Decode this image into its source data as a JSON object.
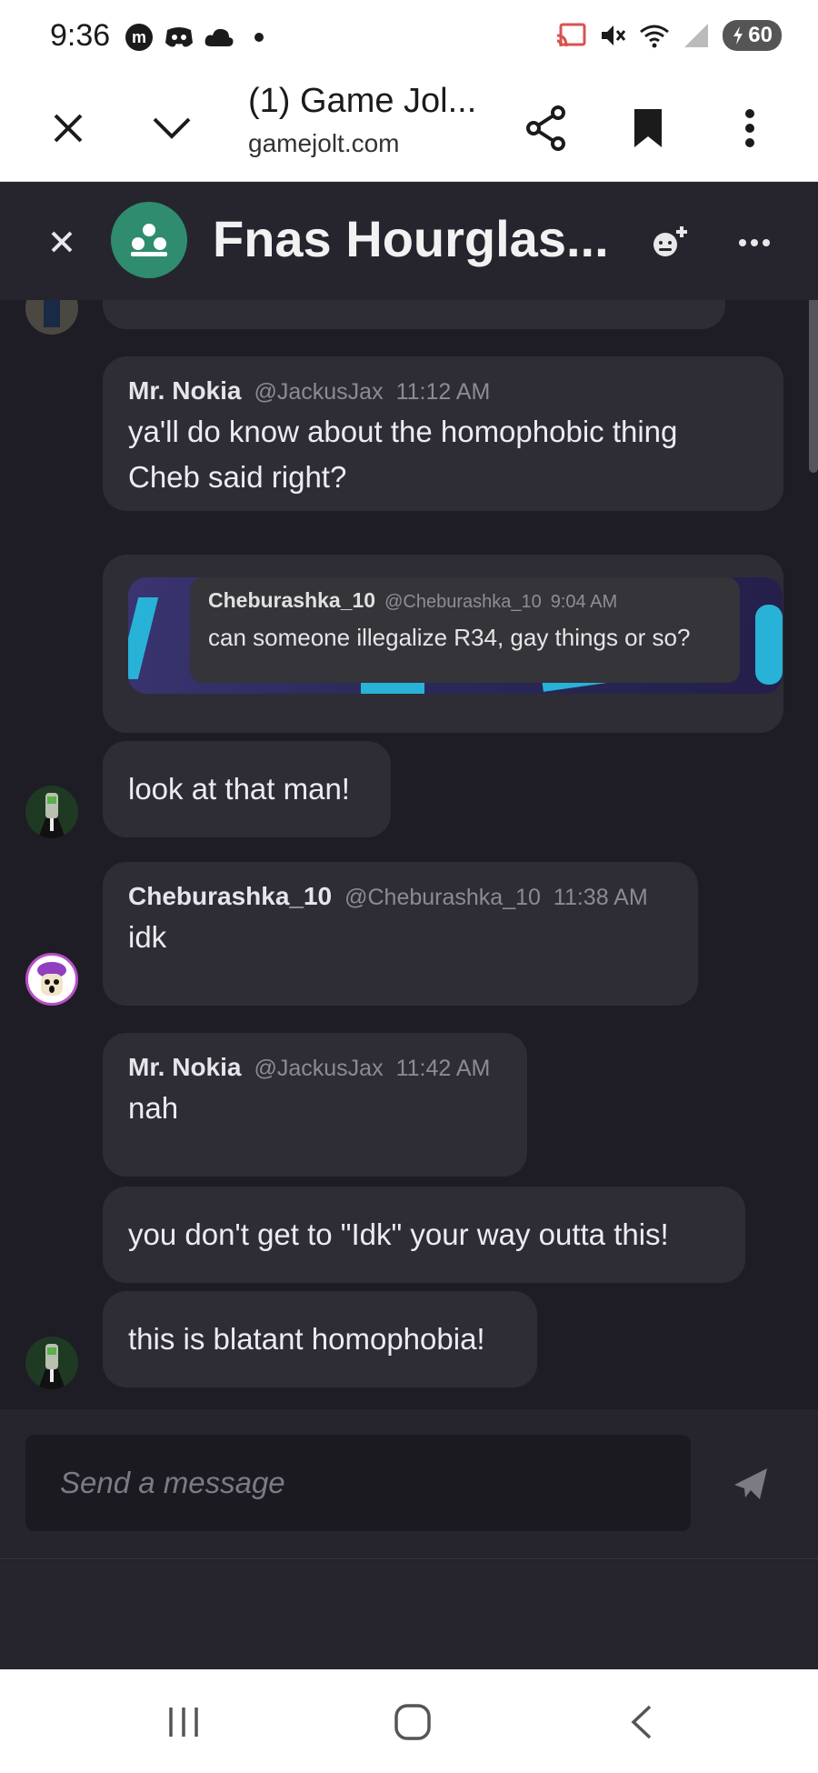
{
  "status_bar": {
    "time": "9:36",
    "battery": "60",
    "left_icons": [
      "m-logo-icon",
      "discord-icon",
      "cloud-icon",
      "dot-icon"
    ],
    "right_icons": [
      "cast-icon",
      "mute-icon",
      "wifi-icon",
      "signal-icon",
      "battery-icon"
    ]
  },
  "browser": {
    "title": "(1) Game Jol...",
    "url": "gamejolt.com"
  },
  "chat": {
    "title": "Fnas Hourglas..."
  },
  "messages": [
    {
      "author": "Mr. Nokia",
      "handle": "@JackusJax",
      "time": "11:12 AM",
      "text_lines": [
        "ya'll do know about the homophobic thing",
        "Cheb said right?"
      ]
    },
    {
      "embed": {
        "author": "Cheburashka_10",
        "handle": "@Cheburashka_10",
        "time": "9:04 AM",
        "text": "can someone illegalize R34, gay things or so?"
      }
    },
    {
      "text": "look at that man!"
    },
    {
      "author": "Cheburashka_10",
      "handle": "@Cheburashka_10",
      "time": "11:38 AM",
      "text": "idk"
    },
    {
      "author": "Mr. Nokia",
      "handle": "@JackusJax",
      "time": "11:42 AM",
      "text": "nah"
    },
    {
      "text": "you don't get to \"Idk\" your way outta this!"
    },
    {
      "text": "this is blatant homophobia!"
    }
  ],
  "composer": {
    "placeholder": "Send a message"
  },
  "colors": {
    "background": "#1e1d25",
    "header": "#26252e",
    "bubble": "#2e2d36",
    "group_avatar": "#2f8c6f",
    "embed_accent": "#28b2d8"
  }
}
